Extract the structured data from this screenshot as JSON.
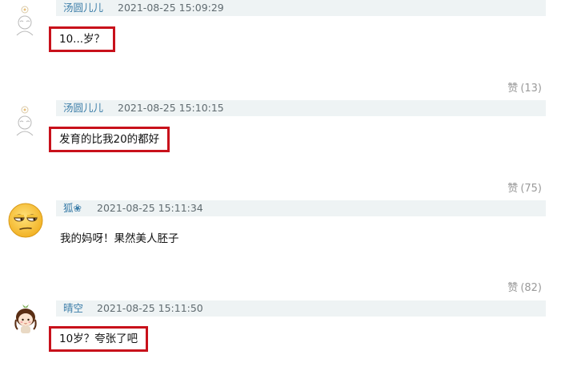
{
  "comments": [
    {
      "user": "汤圆儿儿",
      "time": "2021-08-25 15:09:29",
      "text": "10...岁？",
      "likes": null
    },
    {
      "user": "汤圆儿儿",
      "time": "2021-08-25 15:10:15",
      "text": "发育的比我20的都好",
      "like_label": "赞",
      "likes": "(13)"
    },
    {
      "user": "狐❀",
      "time": "2021-08-25 15:11:34",
      "text": "我的妈呀！果然美人胚子",
      "like_label": "赞",
      "likes": "(75)"
    },
    {
      "user": "晴空",
      "time": "2021-08-25 15:11:50",
      "text": "10岁？夸张了吧",
      "like_label": "赞",
      "likes": "(82)"
    }
  ],
  "colors": {
    "highlight_border": "#c8111b",
    "meta_bg": "#eef3f4",
    "username": "#3b7da8"
  }
}
